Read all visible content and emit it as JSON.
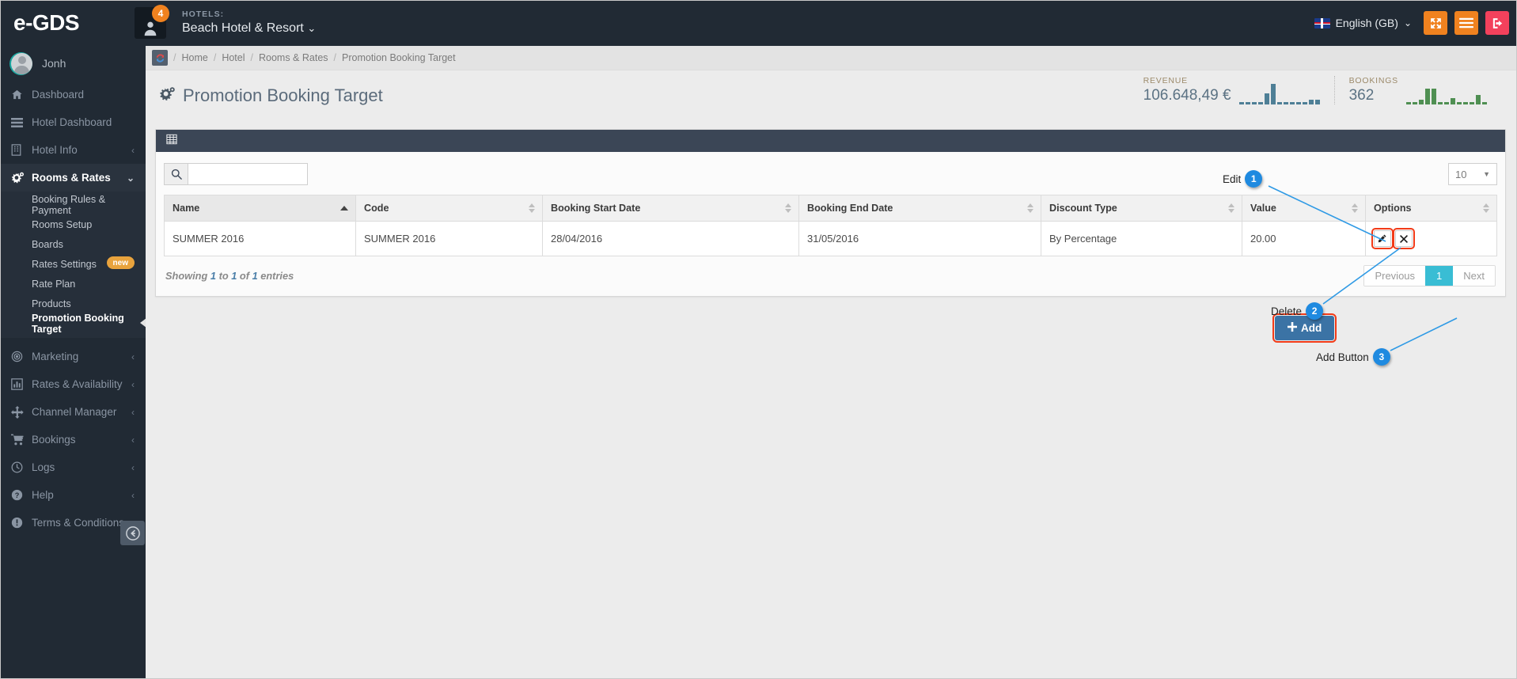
{
  "topbar": {
    "brand": "e-GDS",
    "notification_count": "4",
    "hotels_label": "HOTELS:",
    "hotel_name": "Beach Hotel & Resort",
    "language": "English (GB)",
    "icons": {
      "fullscreen": "fullscreen-icon",
      "menu": "hamburger-icon",
      "logout": "logout-icon"
    }
  },
  "sidebar": {
    "profile_name": "Jonh",
    "items": [
      {
        "label": "Dashboard",
        "icon": "home-icon",
        "caret": "",
        "active": false
      },
      {
        "label": "Hotel Dashboard",
        "icon": "list-icon",
        "caret": "",
        "active": false
      },
      {
        "label": "Hotel Info",
        "icon": "building-icon",
        "caret": "‹",
        "active": false
      },
      {
        "label": "Rooms & Rates",
        "icon": "gears-icon",
        "caret": "⌄",
        "active": true
      },
      {
        "label": "Marketing",
        "icon": "target-icon",
        "caret": "‹",
        "active": false
      },
      {
        "label": "Rates & Availability",
        "icon": "chart-icon",
        "caret": "‹",
        "active": false
      },
      {
        "label": "Channel Manager",
        "icon": "arrows-icon",
        "caret": "‹",
        "active": false
      },
      {
        "label": "Bookings",
        "icon": "cart-icon",
        "caret": "‹",
        "active": false
      },
      {
        "label": "Logs",
        "icon": "clock-icon",
        "caret": "‹",
        "active": false
      },
      {
        "label": "Help",
        "icon": "question-icon",
        "caret": "‹",
        "active": false
      },
      {
        "label": "Terms & Conditions",
        "icon": "exclamation-icon",
        "caret": "",
        "active": false
      }
    ],
    "submenu": [
      {
        "label": "Booking Rules & Payment",
        "badge": "",
        "current": false
      },
      {
        "label": "Rooms Setup",
        "badge": "",
        "current": false
      },
      {
        "label": "Boards",
        "badge": "",
        "current": false
      },
      {
        "label": "Rates Settings",
        "badge": "new",
        "current": false
      },
      {
        "label": "Rate Plan",
        "badge": "",
        "current": false
      },
      {
        "label": "Products",
        "badge": "",
        "current": false
      },
      {
        "label": "Promotion Booking Target",
        "badge": "",
        "current": true
      }
    ]
  },
  "breadcrumb": {
    "refresh_icon": "refresh-icon",
    "items": [
      "Home",
      "Hotel",
      "Rooms & Rates",
      "Promotion Booking Target"
    ]
  },
  "page": {
    "title": "Promotion Booking Target",
    "title_icon": "gears-icon"
  },
  "stats": [
    {
      "label": "REVENUE",
      "value": "106.648,49 €",
      "color": "#4e7f96",
      "spark": [
        2,
        2,
        2,
        2,
        9,
        17,
        2,
        2,
        2,
        2,
        2,
        4,
        4
      ]
    },
    {
      "label": "BOOKINGS",
      "value": "362",
      "color": "#4f8f52",
      "spark": [
        2,
        2,
        4,
        13,
        13,
        2,
        2,
        5,
        2,
        2,
        2,
        8,
        2
      ]
    }
  ],
  "panel": {
    "header_icon": "table-icon",
    "search_placeholder": "",
    "search_value": "",
    "page_length": "10",
    "columns": [
      {
        "label": "Name",
        "sort": "asc"
      },
      {
        "label": "Code",
        "sort": "none"
      },
      {
        "label": "Booking Start Date",
        "sort": "none"
      },
      {
        "label": "Booking End Date",
        "sort": "none"
      },
      {
        "label": "Discount Type",
        "sort": "none"
      },
      {
        "label": "Value",
        "sort": "none"
      },
      {
        "label": "Options",
        "sort": "none"
      }
    ],
    "rows": [
      {
        "name": "SUMMER 2016",
        "code": "SUMMER 2016",
        "start": "28/04/2016",
        "end": "31/05/2016",
        "discount_type": "By Percentage",
        "value": "20.00",
        "edit_icon": "pencil-icon",
        "delete_icon": "cross-icon"
      }
    ],
    "showing_text": {
      "prefix": "Showing",
      "from": "1",
      "mid": "to",
      "to": "1",
      "of": "of",
      "total": "1",
      "suffix": "entries"
    },
    "pagination": {
      "previous": "Previous",
      "current": "1",
      "next": "Next"
    }
  },
  "add_button": {
    "label": "Add",
    "icon": "plus-icon"
  },
  "annotations": [
    {
      "number": "1",
      "label": "Edit"
    },
    {
      "number": "2",
      "label": "Delete"
    },
    {
      "number": "3",
      "label": "Add Button"
    }
  ],
  "colors": {
    "sidebar_bg": "#212a34",
    "accent_orange": "#f0821f",
    "accent_red": "#f3415c",
    "panel_header": "#3b4656",
    "pager_active": "#39bdd4",
    "add_button": "#3b73a5",
    "annotation_bubble": "#1f8ae0",
    "highlight_outline": "#f23b18"
  }
}
